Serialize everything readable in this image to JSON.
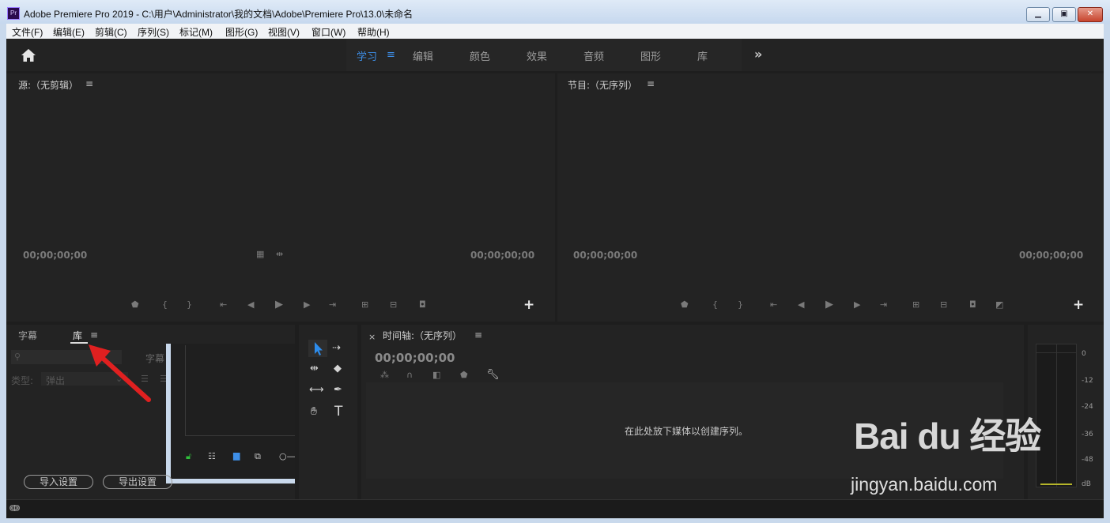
{
  "window": {
    "app_icon": "Pr",
    "title": "Adobe Premiere Pro 2019 - C:\\用户\\Administrator\\我的文档\\Adobe\\Premiere Pro\\13.0\\未命名",
    "minimize_icon": "minimize-icon",
    "maximize_icon": "maximize-icon",
    "close_icon": "close-icon"
  },
  "menubar": [
    "文件(F)",
    "编辑(E)",
    "剪辑(C)",
    "序列(S)",
    "标记(M)",
    "图形(G)",
    "视图(V)",
    "窗口(W)",
    "帮助(H)"
  ],
  "workspaces": {
    "tabs": [
      "学习",
      "编辑",
      "颜色",
      "效果",
      "音频",
      "图形",
      "库"
    ],
    "active": "学习",
    "accent": "#3e8fe8"
  },
  "source_monitor": {
    "title": "源:（无剪辑）",
    "timecode_left": "00;00;00;00",
    "timecode_right": "00;00;00;00"
  },
  "program_monitor": {
    "title": "节目:（无序列）",
    "timecode_left": "00;00;00;00",
    "timecode_right": "00;00;00;00"
  },
  "bottom_left": {
    "tab_captions": "字幕",
    "tab_library": "库",
    "caption_search_label": "字幕",
    "type_label": "类型:",
    "type_value": "弹出",
    "import_button": "导入设置",
    "export_button": "导出设置"
  },
  "timeline": {
    "title": "时间轴:（无序列）",
    "timecode": "00;00;00;00",
    "drop_message": "在此处放下媒体以创建序列。"
  },
  "audio_meter": {
    "scale": [
      "0",
      "-12",
      "-24",
      "-36",
      "-48",
      "dB"
    ]
  },
  "watermark": {
    "logo": "Bai du 经验",
    "url": "jingyan.baidu.com"
  }
}
